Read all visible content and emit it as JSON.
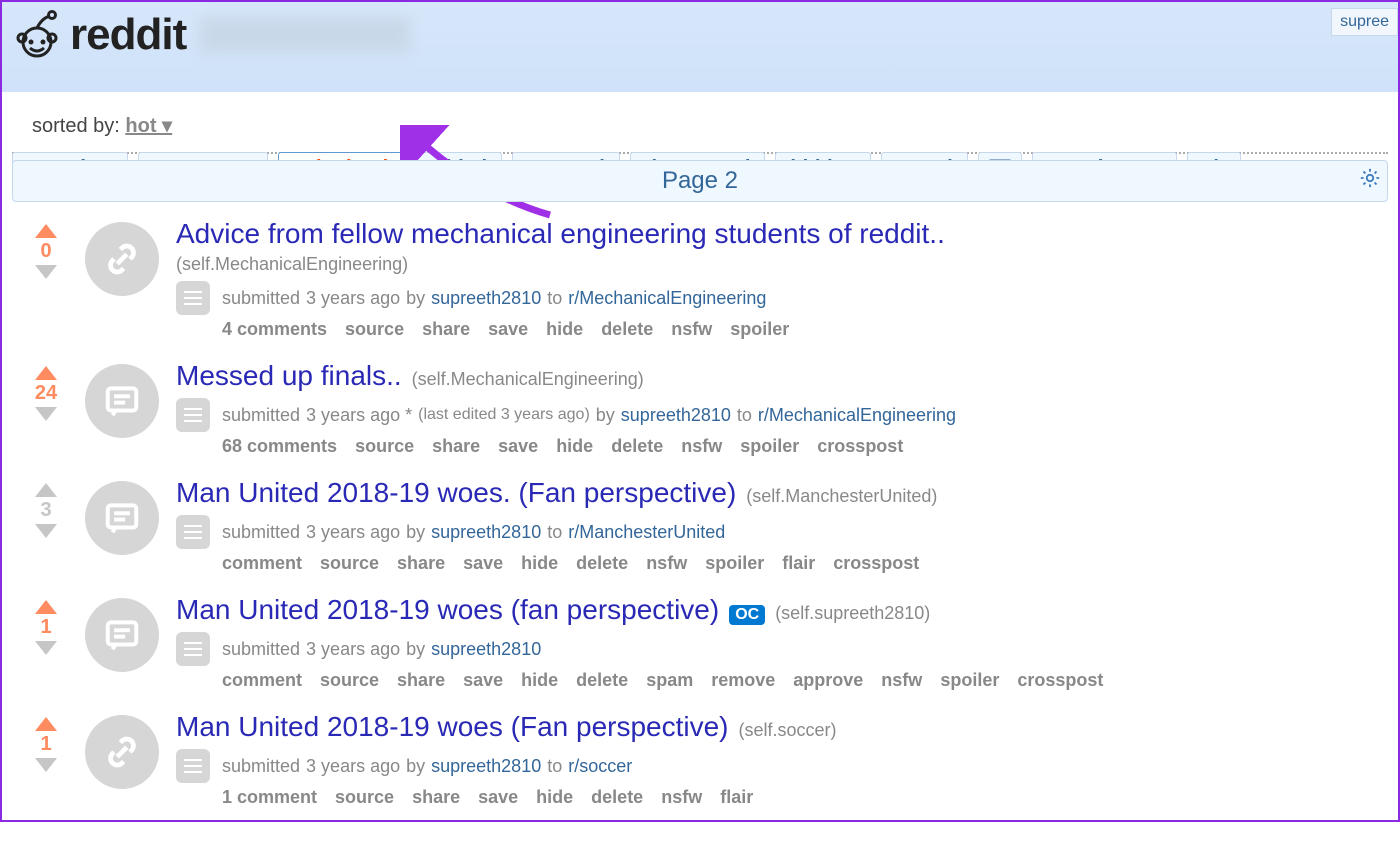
{
  "header": {
    "site_name": "reddit",
    "user_corner": "supree"
  },
  "tabs": {
    "items": [
      "overview",
      "comments",
      "submitted",
      "gilded",
      "upvoted",
      "downvoted",
      "hidden",
      "saved"
    ],
    "extra": [
      "saved - RES",
      "sh"
    ],
    "active_index": 2
  },
  "sort": {
    "label": "sorted by:",
    "value": "hot"
  },
  "page_banner": "Page 2",
  "posts": [
    {
      "score": "0",
      "liked": true,
      "thumb": "link",
      "title": "Advice from fellow mechanical engineering students of reddit..",
      "domain": "(self.MechanicalEngineering)",
      "domain_inline": false,
      "submitted_prefix": "submitted",
      "time": "3 years ago",
      "edited": "",
      "by": "by",
      "author": "supreeth2810",
      "to": "to",
      "sub": "r/MechanicalEngineering",
      "actions": [
        "4 comments",
        "source",
        "share",
        "save",
        "hide",
        "delete",
        "nsfw",
        "spoiler"
      ]
    },
    {
      "score": "24",
      "liked": true,
      "thumb": "text",
      "title": "Messed up finals..",
      "domain": "(self.MechanicalEngineering)",
      "domain_inline": true,
      "submitted_prefix": "submitted",
      "time": "3 years ago *",
      "edited": "(last edited 3 years ago)",
      "by": "by",
      "author": "supreeth2810",
      "to": "to",
      "sub": "r/MechanicalEngineering",
      "actions": [
        "68 comments",
        "source",
        "share",
        "save",
        "hide",
        "delete",
        "nsfw",
        "spoiler",
        "crosspost"
      ]
    },
    {
      "score": "3",
      "liked": false,
      "thumb": "text",
      "title": "Man United 2018-19 woes. (Fan perspective)",
      "domain": "(self.ManchesterUnited)",
      "domain_inline": true,
      "submitted_prefix": "submitted",
      "time": "3 years ago",
      "edited": "",
      "by": "by",
      "author": "supreeth2810",
      "to": "to",
      "sub": "r/ManchesterUnited",
      "actions": [
        "comment",
        "source",
        "share",
        "save",
        "hide",
        "delete",
        "nsfw",
        "spoiler",
        "flair",
        "crosspost"
      ]
    },
    {
      "score": "1",
      "liked": true,
      "thumb": "text",
      "oc": "OC",
      "title": "Man United 2018-19 woes (fan perspective)",
      "domain": "(self.supreeth2810)",
      "domain_inline": true,
      "submitted_prefix": "submitted",
      "time": "3 years ago",
      "edited": "",
      "by": "by",
      "author": "supreeth2810",
      "to": "",
      "sub": "",
      "actions": [
        "comment",
        "source",
        "share",
        "save",
        "hide",
        "delete",
        "spam",
        "remove",
        "approve",
        "nsfw",
        "spoiler",
        "crosspost"
      ]
    },
    {
      "score": "1",
      "liked": true,
      "thumb": "link",
      "title": "Man United 2018-19 woes (Fan perspective)",
      "domain": "(self.soccer)",
      "domain_inline": true,
      "submitted_prefix": "submitted",
      "time": "3 years ago",
      "edited": "",
      "by": "by",
      "author": "supreeth2810",
      "to": "to",
      "sub": "r/soccer",
      "actions": [
        "1 comment",
        "source",
        "share",
        "save",
        "hide",
        "delete",
        "nsfw",
        "flair"
      ]
    }
  ]
}
